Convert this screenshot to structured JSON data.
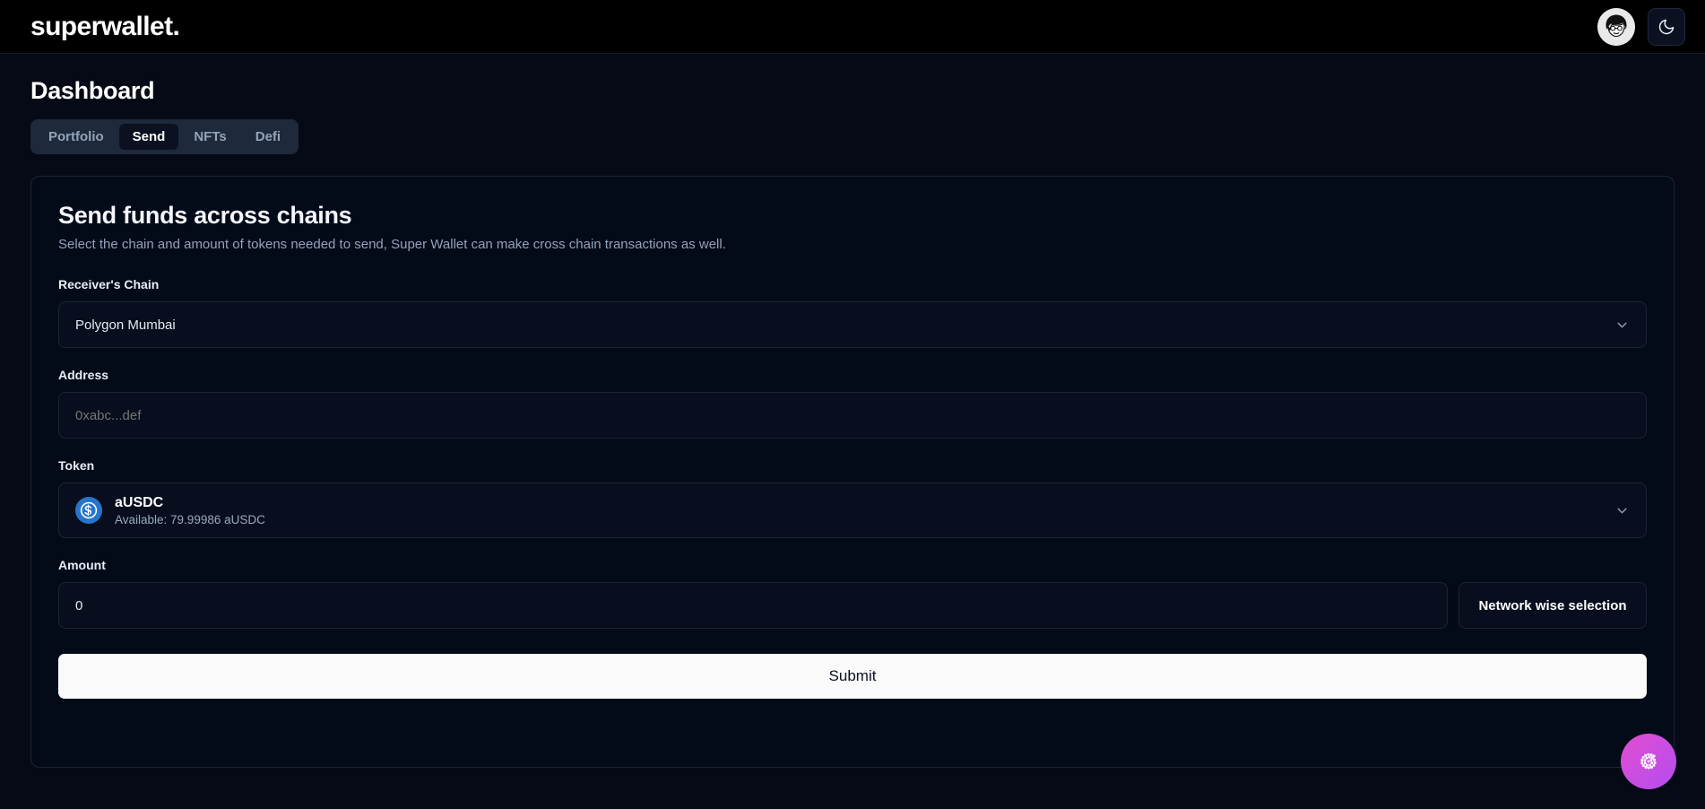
{
  "header": {
    "brand": "superwallet.",
    "avatar_name": "user-avatar",
    "theme_toggle_icon": "moon-icon"
  },
  "page": {
    "title": "Dashboard",
    "tabs": [
      {
        "label": "Portfolio",
        "active": false
      },
      {
        "label": "Send",
        "active": true
      },
      {
        "label": "NFTs",
        "active": false
      },
      {
        "label": "Defi",
        "active": false
      }
    ]
  },
  "card": {
    "title": "Send funds across chains",
    "subtitle": "Select the chain and amount of tokens needed to send, Super Wallet can make cross chain transactions as well.",
    "chain": {
      "label": "Receiver's Chain",
      "value": "Polygon Mumbai",
      "chevron_icon": "chevron-down-icon"
    },
    "address": {
      "label": "Address",
      "placeholder": "0xabc...def",
      "value": ""
    },
    "token": {
      "label": "Token",
      "symbol": "aUSDC",
      "available": "Available: 79.99986 aUSDC",
      "icon": "usdc-coin-icon",
      "chevron_icon": "chevron-down-icon"
    },
    "amount": {
      "label": "Amount",
      "value": "0",
      "placeholder": "0"
    },
    "network_button": "Network wise selection",
    "submit_button": "Submit"
  },
  "fab": {
    "name": "support-widget-button",
    "icon": "spiral-logo-icon"
  },
  "colors": {
    "page_bg": "#050a16",
    "header_bg": "#000000",
    "card_bg": "#030a18",
    "border": "#1b2537",
    "tabs_bg": "#1e293b",
    "active_tab_bg": "#0b1120",
    "muted_text": "#93a3ba",
    "submit_bg": "#fafafa",
    "usdc_blue": "#2775ca",
    "fab_from": "#e24fd0",
    "fab_to": "#b44cf0"
  }
}
